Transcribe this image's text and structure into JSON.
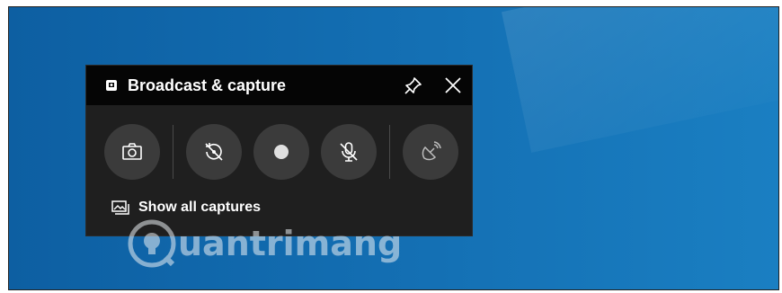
{
  "widget": {
    "title": "Broadcast & capture",
    "show_captures_label": "Show all captures"
  },
  "buttons": [
    {
      "name": "take-screenshot-button",
      "icon": "camera-icon"
    },
    {
      "name": "record-last-30s-button",
      "icon": "rewind-record-icon"
    },
    {
      "name": "start-recording-button",
      "icon": "record-dot-icon"
    },
    {
      "name": "microphone-toggle-button",
      "icon": "mic-off-icon"
    },
    {
      "name": "broadcast-button",
      "icon": "broadcast-icon"
    }
  ],
  "watermark": {
    "text": "uantrimang"
  },
  "colors": {
    "desktop": "#1470b4",
    "widget_body": "#1f1f1f",
    "titlebar": "#050505",
    "button": "#3b3b3b"
  }
}
